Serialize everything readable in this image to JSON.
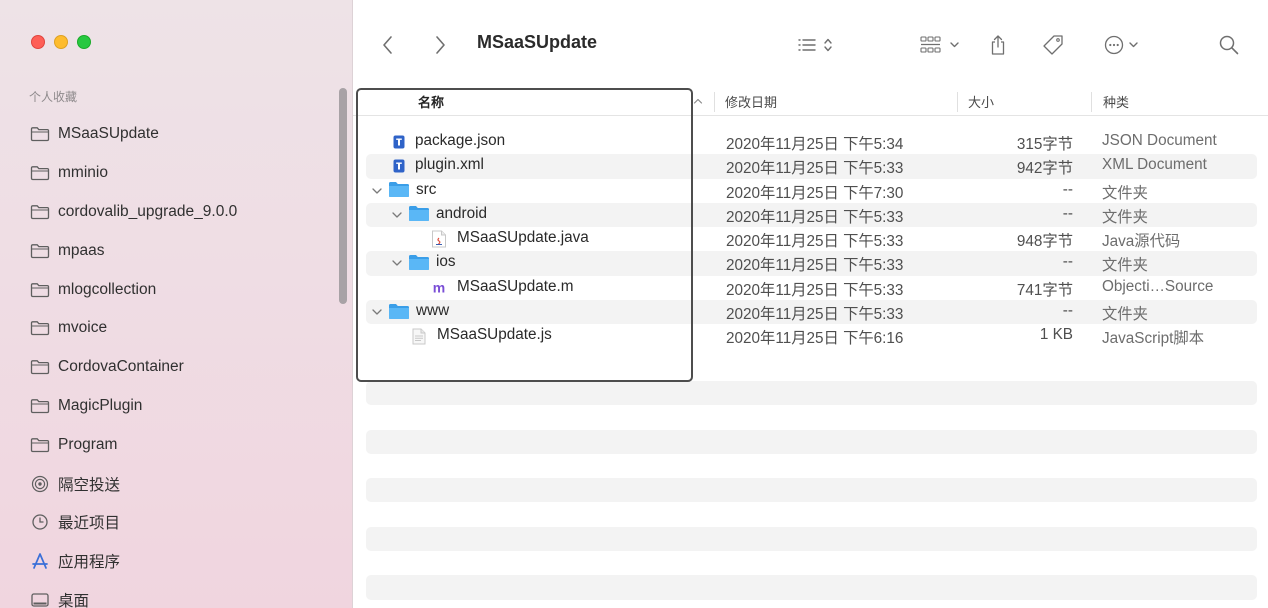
{
  "window": {
    "title": "MSaaSUpdate"
  },
  "sidebar": {
    "section_label": "个人收藏",
    "items": [
      {
        "label": "MSaaSUpdate",
        "icon": "folder-icon"
      },
      {
        "label": "mminio",
        "icon": "folder-icon"
      },
      {
        "label": "cordovalib_upgrade_9.0.0",
        "icon": "folder-icon"
      },
      {
        "label": "mpaas",
        "icon": "folder-icon"
      },
      {
        "label": "mlogcollection",
        "icon": "folder-icon"
      },
      {
        "label": "mvoice",
        "icon": "folder-icon"
      },
      {
        "label": "CordovaContainer",
        "icon": "folder-icon"
      },
      {
        "label": "MagicPlugin",
        "icon": "folder-icon"
      },
      {
        "label": "Program",
        "icon": "folder-icon"
      },
      {
        "label": "隔空投送",
        "icon": "airdrop-icon"
      },
      {
        "label": "最近项目",
        "icon": "clock-icon"
      },
      {
        "label": "应用程序",
        "icon": "applications-icon"
      },
      {
        "label": "桌面",
        "icon": "desktop-icon"
      }
    ]
  },
  "toolbar": {
    "title": "MSaaSUpdate",
    "icons": [
      "back-icon",
      "forward-icon",
      "list-view-icon",
      "grid-view-icon",
      "share-icon",
      "tag-icon",
      "more-icon",
      "search-icon"
    ]
  },
  "columns": {
    "name": "名称",
    "date": "修改日期",
    "size": "大小",
    "kind": "种类"
  },
  "files": [
    {
      "name": "package.json",
      "date": "2020年11月25日 下午5:34",
      "size": "315字节",
      "kind": "JSON Document",
      "level": 1,
      "type": "json",
      "expandable": false
    },
    {
      "name": "plugin.xml",
      "date": "2020年11月25日 下午5:33",
      "size": "942字节",
      "kind": "XML Document",
      "level": 1,
      "type": "xml",
      "expandable": false
    },
    {
      "name": "src",
      "date": "2020年11月25日 下午7:30",
      "size": "--",
      "kind": "文件夹",
      "level": 0,
      "type": "folder",
      "expandable": true
    },
    {
      "name": "android",
      "date": "2020年11月25日 下午5:33",
      "size": "--",
      "kind": "文件夹",
      "level": 1,
      "type": "folder",
      "expandable": true
    },
    {
      "name": "MSaaSUpdate.java",
      "date": "2020年11月25日 下午5:33",
      "size": "948字节",
      "kind": "Java源代码",
      "level": 3,
      "type": "java",
      "expandable": false
    },
    {
      "name": "ios",
      "date": "2020年11月25日 下午5:33",
      "size": "--",
      "kind": "文件夹",
      "level": 1,
      "type": "folder",
      "expandable": true
    },
    {
      "name": "MSaaSUpdate.m",
      "date": "2020年11月25日 下午5:33",
      "size": "741字节",
      "kind": "Objecti…Source",
      "level": 3,
      "type": "objc",
      "expandable": false
    },
    {
      "name": "www",
      "date": "2020年11月25日 下午5:33",
      "size": "--",
      "kind": "文件夹",
      "level": 0,
      "type": "folder",
      "expandable": true
    },
    {
      "name": "MSaaSUpdate.js",
      "date": "2020年11月25日 下午6:16",
      "size": "1 KB",
      "kind": "JavaScript脚本",
      "level": 2,
      "type": "js",
      "expandable": false
    }
  ],
  "colors": {
    "folder": "#5ab7f6",
    "selection_border": "#4d4d4d",
    "row_alt": "#f3f3f3"
  }
}
